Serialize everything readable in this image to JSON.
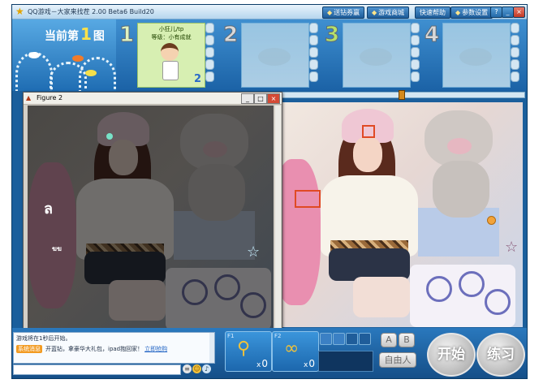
{
  "window": {
    "title": "QQ游戏－大家来找茬 2.00  Beta6  Build20",
    "buttons": [
      "送钻券赢",
      "游戏商城",
      "快速帮助",
      "参数设置"
    ],
    "controls": {
      "help": "?",
      "minimize": "_",
      "maximize": "□",
      "close": "×"
    }
  },
  "header": {
    "round_prefix": "当前第",
    "round_number": "1",
    "round_suffix": "图",
    "slots": [
      {
        "num": "1",
        "player": "小狂儿/tp",
        "level": "等级：小有成就",
        "score": "2",
        "active": true
      },
      {
        "num": "2",
        "active": false
      },
      {
        "num": "3",
        "active": false
      },
      {
        "num": "4",
        "active": false
      }
    ]
  },
  "figure": {
    "title": "Figure 2",
    "blob_text": "ฆฆ"
  },
  "chat": {
    "line1": "游戏将在1秒后开始。",
    "tag": "系统消息",
    "line2": "开蓝钻，拿豪华大礼包，ipad抱回家！",
    "link": "立即抢购"
  },
  "tools": [
    {
      "key": "F1",
      "count": "0",
      "icon": "magnifier-icon"
    },
    {
      "key": "F2",
      "count": "0",
      "icon": "glasses-icon"
    }
  ],
  "tool_count_prefix": "x",
  "buttons": {
    "a": "A",
    "b": "B",
    "free": "自由人",
    "start": "开始",
    "practice": "练习"
  },
  "colors": {
    "marker_square": "#e04a24",
    "marker_dot": "#f2a33a",
    "figure_dot": "#78e2c8"
  }
}
